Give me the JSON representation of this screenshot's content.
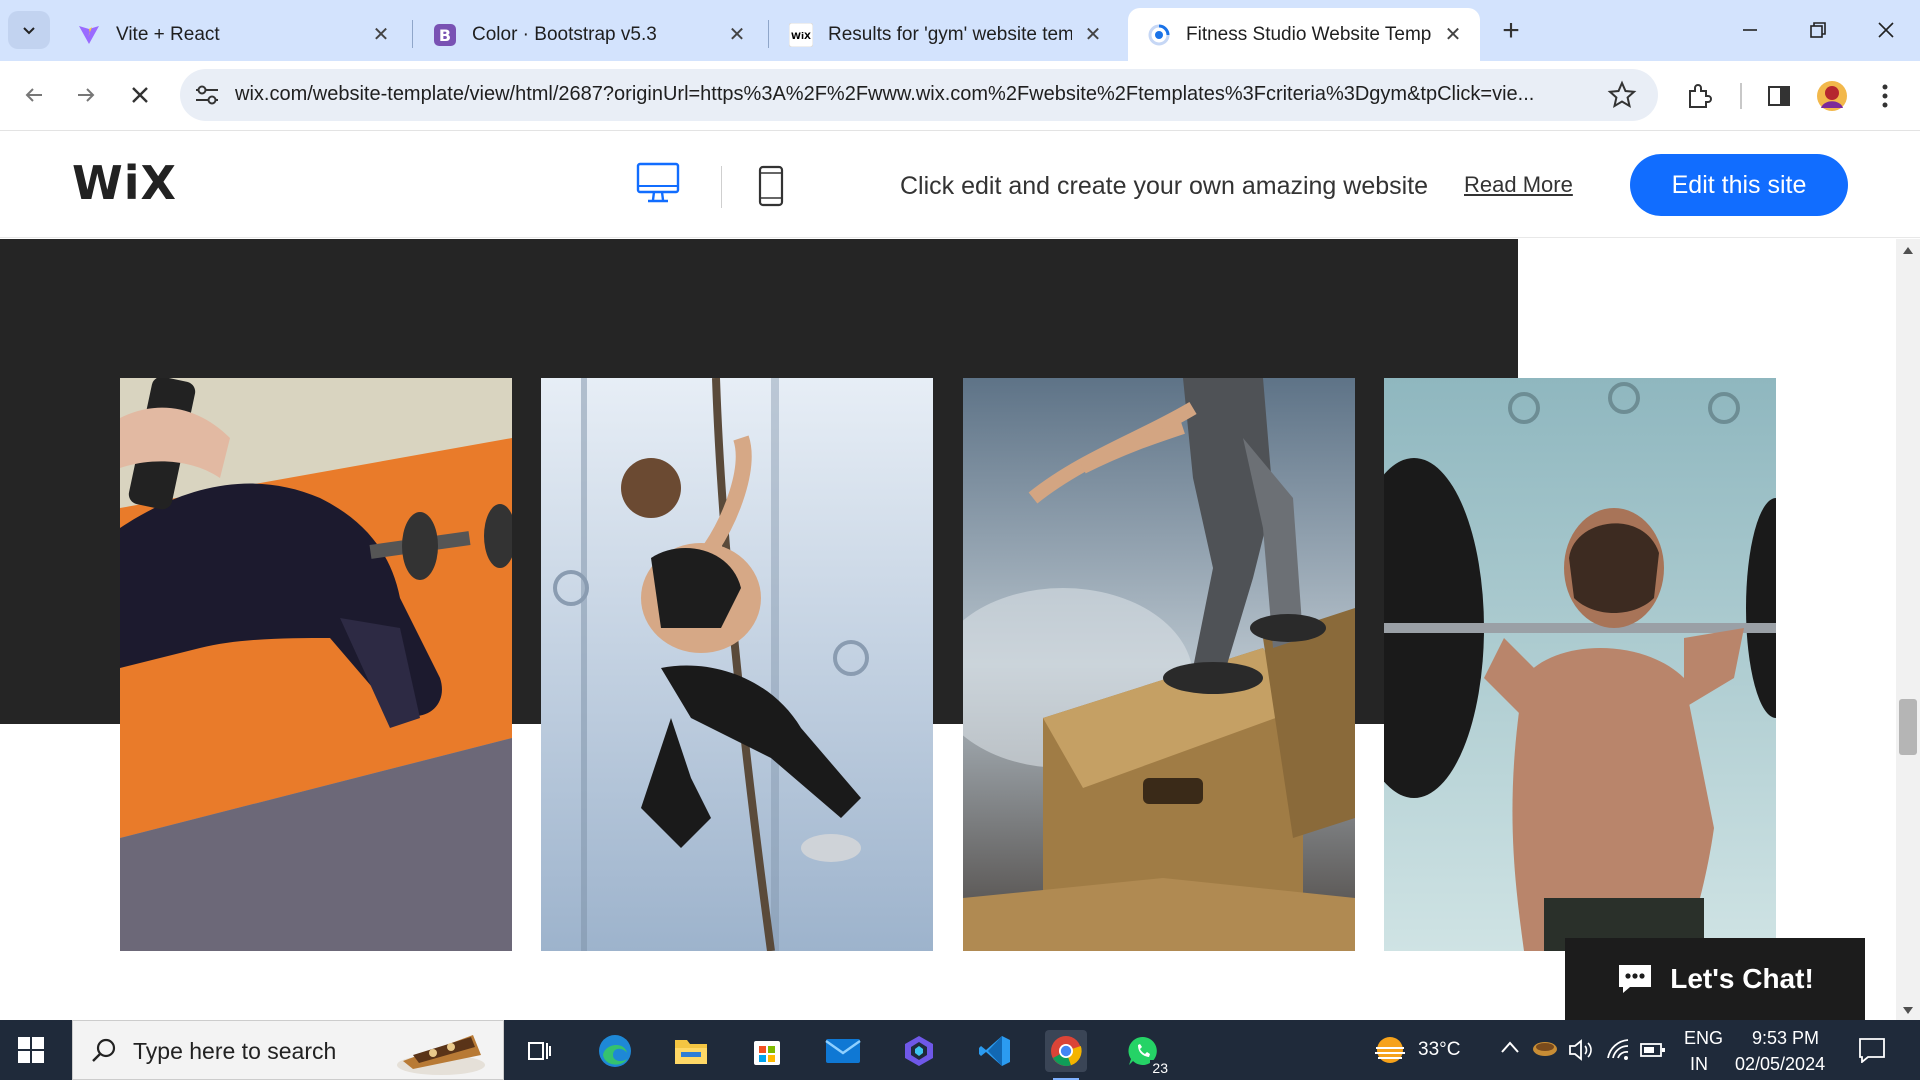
{
  "browser": {
    "tabs": [
      {
        "title": "Vite + React",
        "icon": "vite-icon",
        "active": false
      },
      {
        "title": "Color · Bootstrap v5.3",
        "icon": "bootstrap-icon",
        "active": false
      },
      {
        "title": "Results for 'gym' website templ",
        "icon": "wix-favicon",
        "favicon_text": "WiX",
        "active": false
      },
      {
        "title": "Fitness Studio Website Templat",
        "icon": "loading-spinner-icon",
        "active": true
      }
    ],
    "new_tab_label": "+",
    "url": "wix.com/website-template/view/html/2687?originUrl=https%3A%2F%2Fwww.wix.com%2Fwebsite%2Ftemplates%3Fcriteria%3Dgym&tpClick=vie..."
  },
  "wix": {
    "logo": "WiX",
    "tagline": "Click edit and create your own amazing website",
    "read_more": "Read More",
    "edit_button": "Edit this site",
    "view_modes": [
      "desktop-icon",
      "mobile-icon"
    ],
    "active_view": "desktop"
  },
  "gallery": {
    "photos": [
      {
        "label": "woman-stretching-with-dumbbell-photo"
      },
      {
        "label": "woman-climbing-rope-photo"
      },
      {
        "label": "box-jump-photo"
      },
      {
        "label": "man-lifting-barbell-photo"
      }
    ]
  },
  "chat_widget": {
    "label": "Let's Chat!"
  },
  "taskbar": {
    "search_placeholder": "Type here to search",
    "apps": [
      "task-view-icon",
      "edge-icon",
      "file-explorer-icon",
      "microsoft-store-icon",
      "mail-icon",
      "copilot-icon",
      "vscode-icon",
      "chrome-icon",
      "whatsapp-icon"
    ],
    "whatsapp_badge": "23",
    "weather": "33°C",
    "language": "ENG",
    "region": "IN",
    "time": "9:53 PM",
    "date": "02/05/2024"
  }
}
